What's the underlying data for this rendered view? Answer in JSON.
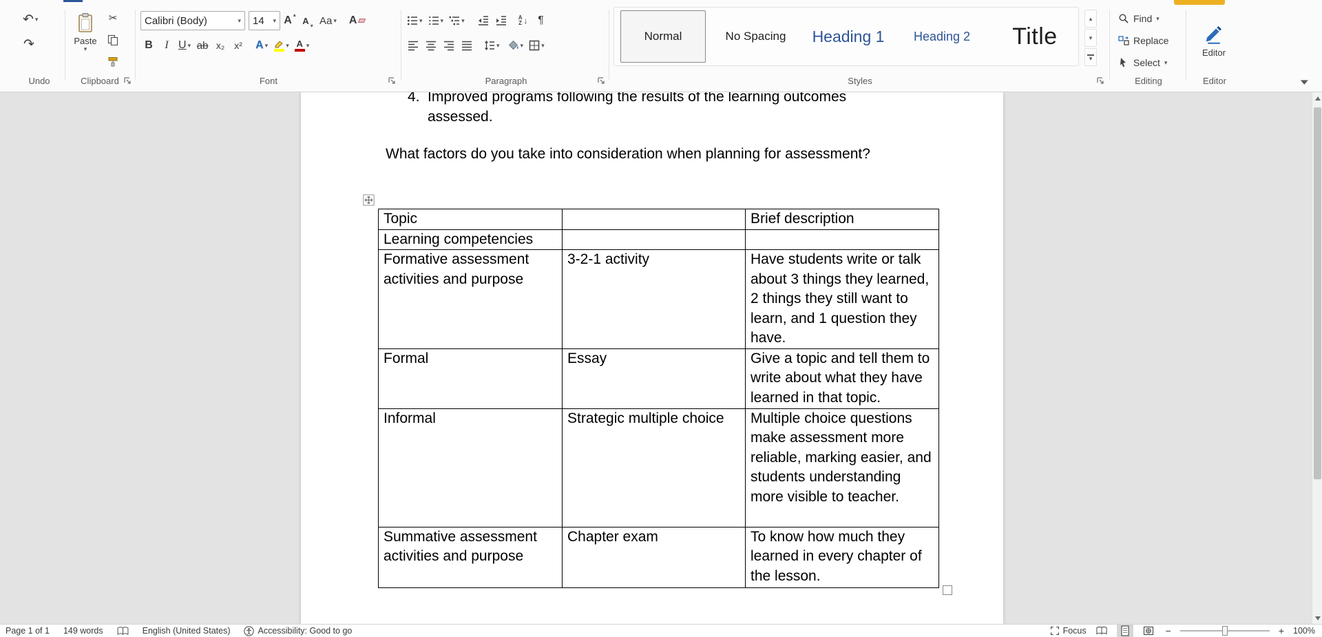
{
  "colors": {
    "heading_blue": "#2f5496",
    "accent_blue": "#2b6cb8",
    "highlight_yellow": "#ffff00",
    "font_color_red": "#c00000",
    "tab_underline": "#2b579a",
    "badge_yellow": "#edb021"
  },
  "glyphs": {
    "chevron_down": "▾",
    "chevron_up": "▴",
    "undo": "↶",
    "redo": "↷",
    "cut": "✂",
    "bold": "B",
    "italic": "I",
    "underline": "U",
    "strikethrough": "ab",
    "subscript": "x₂",
    "superscript": "x²",
    "change_case": "Aa",
    "grow_font": "A",
    "shrink_font": "A",
    "clear_formatting": "A",
    "text_effects": "A",
    "font_color_letter": "A",
    "pilcrow": "¶",
    "sort_a": "A",
    "sort_z": "Z",
    "arrow_down": "↓",
    "minus": "−",
    "plus": "+"
  },
  "ribbon": {
    "undo_group": {
      "label": "Undo"
    },
    "clipboard_group": {
      "label": "Clipboard",
      "paste": "Paste"
    },
    "font_group": {
      "label": "Font",
      "font_name": "Calibri (Body)",
      "font_size": "14"
    },
    "paragraph_group": {
      "label": "Paragraph"
    },
    "styles_group": {
      "label": "Styles",
      "styles": [
        {
          "name": "Normal"
        },
        {
          "name": "No Spacing"
        },
        {
          "name": "Heading 1"
        },
        {
          "name": "Heading 2"
        },
        {
          "name": "Title"
        }
      ]
    },
    "editing_group": {
      "label": "Editing",
      "find": "Find",
      "replace": "Replace",
      "select": "Select"
    },
    "editor_group": {
      "label": "Editor",
      "button": "Editor"
    }
  },
  "document": {
    "list_item": {
      "number": "4.",
      "text": "Improved programs following the results of the learning outcomes assessed."
    },
    "question": "What factors do you take into consideration when planning for assessment?",
    "table": {
      "rows": [
        [
          "Topic",
          "",
          "Brief description"
        ],
        [
          "Learning competencies",
          "",
          ""
        ],
        [
          "Formative assessment activities and purpose",
          "3-2-1 activity",
          "Have students write or talk about 3 things they learned, 2 things they still want to learn, and 1 question they have."
        ],
        [
          "Formal",
          "Essay",
          "Give a topic and tell them to write about what they have learned in that topic."
        ],
        [
          "Informal",
          "Strategic multiple choice",
          "Multiple choice questions make assessment more reliable, marking easier, and students understanding more visible to teacher."
        ],
        [
          "Summative assessment activities and purpose",
          "Chapter exam",
          "To know how much they learned in every chapter of the lesson."
        ]
      ]
    }
  },
  "status_bar": {
    "page": "Page 1 of 1",
    "words": "149 words",
    "language": "English (United States)",
    "accessibility": "Accessibility: Good to go",
    "focus": "Focus",
    "zoom_level": "100%"
  }
}
